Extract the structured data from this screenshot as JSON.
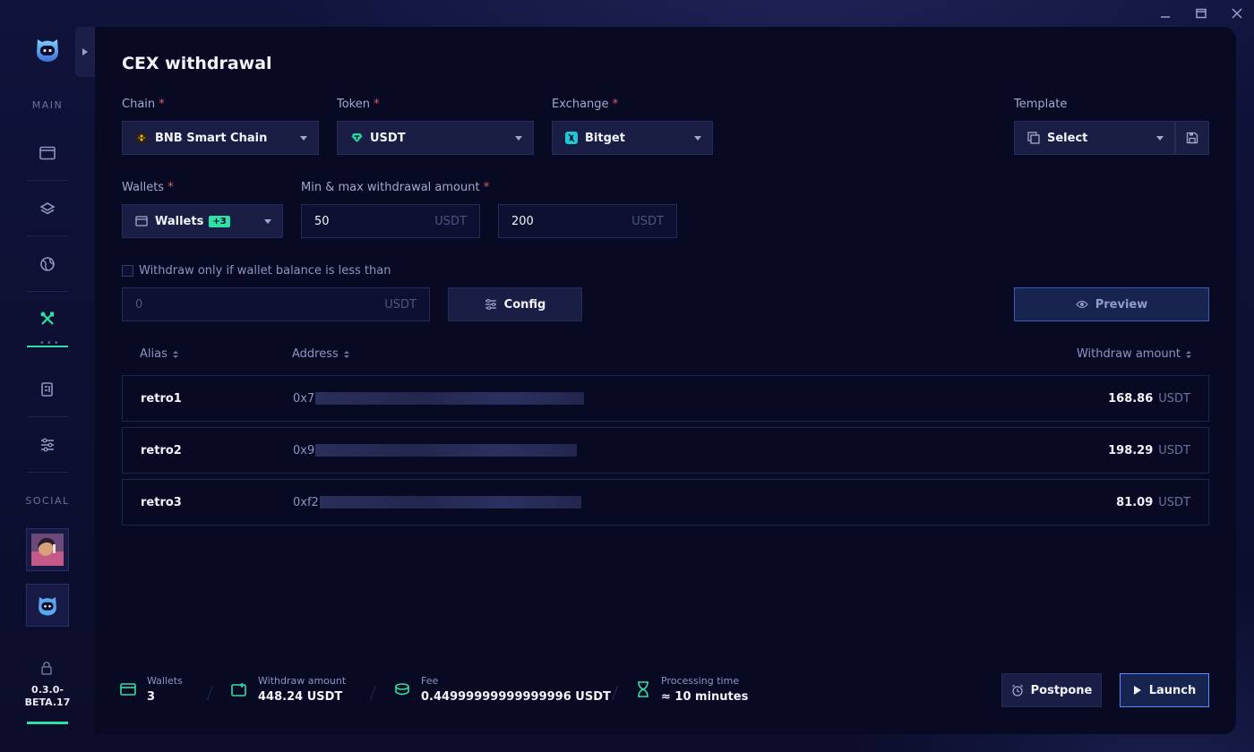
{
  "window": {
    "minimize_icon": "minimize-icon",
    "maximize_icon": "maximize-icon",
    "close_icon": "close-icon"
  },
  "sidebar": {
    "main_label": "MAIN",
    "social_label": "SOCIAL",
    "items": [
      {
        "name": "window",
        "icon": "browser-window-icon"
      },
      {
        "name": "layers",
        "icon": "layers-icon"
      },
      {
        "name": "globe",
        "icon": "globe-icon"
      },
      {
        "name": "tools",
        "icon": "tools-icon",
        "active": true
      },
      {
        "name": "report",
        "icon": "report-icon"
      },
      {
        "name": "settings",
        "icon": "sliders-icon"
      }
    ],
    "version": "0.3.0-\nBETA.17",
    "version_line1": "0.3.0-",
    "version_line2": "BETA.17"
  },
  "page": {
    "title": "CEX withdrawal"
  },
  "form": {
    "chain": {
      "label": "Chain",
      "value": "BNB Smart Chain"
    },
    "token": {
      "label": "Token",
      "value": "USDT"
    },
    "exchange": {
      "label": "Exchange",
      "value": "Bitget"
    },
    "template": {
      "label": "Template",
      "value": "Select"
    },
    "wallets": {
      "label": "Wallets",
      "value": "Wallets",
      "badge": "+3"
    },
    "amount": {
      "label": "Min & max withdrawal amount",
      "min": "50",
      "max": "200",
      "unit": "USDT"
    },
    "balance_check": {
      "label": "Withdraw only if wallet balance is less than",
      "value": "0",
      "unit": "USDT"
    },
    "config_label": "Config",
    "preview_label": "Preview",
    "required_mark": "*"
  },
  "table": {
    "columns": {
      "alias": "Alias",
      "address": "Address",
      "amount": "Withdraw amount"
    },
    "rows": [
      {
        "alias": "retro1",
        "address_prefix": "0x7",
        "amount": "168.86",
        "unit": "USDT"
      },
      {
        "alias": "retro2",
        "address_prefix": "0x9",
        "amount": "198.29",
        "unit": "USDT"
      },
      {
        "alias": "retro3",
        "address_prefix": "0xf2",
        "amount": "81.09",
        "unit": "USDT"
      }
    ]
  },
  "footer": {
    "wallets": {
      "label": "Wallets",
      "value": "3"
    },
    "withdraw_amount": {
      "label": "Withdraw amount",
      "value": "448.24 USDT"
    },
    "fee": {
      "label": "Fee",
      "value": "0.44999999999999996 USDT"
    },
    "processing": {
      "label": "Processing time",
      "value": "≈ 10 minutes"
    },
    "postpone_label": "Postpone",
    "launch_label": "Launch"
  },
  "colors": {
    "accent": "#2ee0a6",
    "background": "#080a24",
    "launch_border": "#5b8cff",
    "required": "#e45b6b"
  }
}
